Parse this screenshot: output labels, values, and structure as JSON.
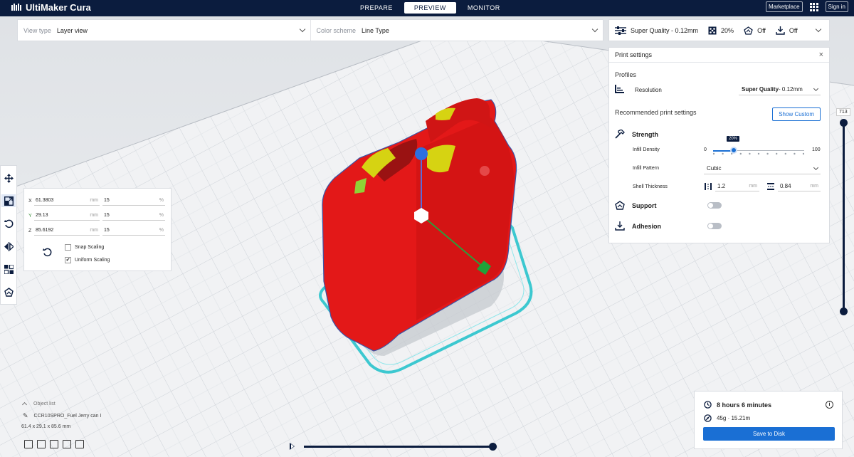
{
  "app": {
    "title": "UltiMaker Cura"
  },
  "stages": [
    {
      "label": "PREPARE"
    },
    {
      "label": "PREVIEW"
    },
    {
      "label": "MONITOR"
    }
  ],
  "top_right": {
    "marketplace": "Marketplace",
    "signin": "Sign in"
  },
  "viewbar": {
    "view_type_label": "View type",
    "view_type_value": "Layer view",
    "color_scheme_label": "Color scheme",
    "color_scheme_value": "Line Type"
  },
  "printbar": {
    "profile": "Super Quality - 0.12mm",
    "infill": "20%",
    "support": "Off",
    "adhesion": "Off"
  },
  "panel": {
    "title": "Print settings",
    "close": "×",
    "profiles_title": "Profiles",
    "resolution_label": "Resolution",
    "resolution_value_bold": "Super Quality",
    "resolution_value_rest": " - 0.12mm",
    "recommended_title": "Recommended print settings",
    "show_custom": "Show Custom",
    "strength": "Strength",
    "infill_density_label": "Infill Density",
    "infill_min": "0",
    "infill_max": "100",
    "infill_tooltip": "20%",
    "infill_value": 20,
    "infill_pattern_label": "Infill Pattern",
    "infill_pattern_value": "Cubic",
    "shell_thickness_label": "Shell Thickness",
    "wall_value": "1.2",
    "top_bottom_value": "0.84",
    "unit_mm": "mm",
    "support": "Support",
    "adhesion": "Adhesion"
  },
  "scale_panel": {
    "rows": [
      {
        "axis": "X",
        "mm": "61.3803",
        "pct": "15"
      },
      {
        "axis": "Y",
        "mm": "29.13",
        "pct": "15"
      },
      {
        "axis": "Z",
        "mm": "85.6192",
        "pct": "15"
      }
    ],
    "unit_mm": "mm",
    "unit_pct": "%",
    "snap_scaling": "Snap Scaling",
    "uniform_scaling": "Uniform Scaling",
    "uniform_checked": "✔"
  },
  "layer_slider": {
    "top_value": "713"
  },
  "object_list": {
    "title": "Object list",
    "object_name": "CCR10SPRO_Fuel Jerry can I",
    "dimensions": "61.4 x 29.1 x 85.6 mm"
  },
  "estimate": {
    "time": "8 hours 6 minutes",
    "material": "45g · 15.21m",
    "save": "Save to Disk",
    "info": "i"
  },
  "colors": {
    "navy": "#0b1c3e",
    "accent_blue": "#1a6fd4",
    "model_red": "#e31818",
    "skirt_cyan": "#3cc8d0",
    "infill_yellow": "#d6d312"
  }
}
